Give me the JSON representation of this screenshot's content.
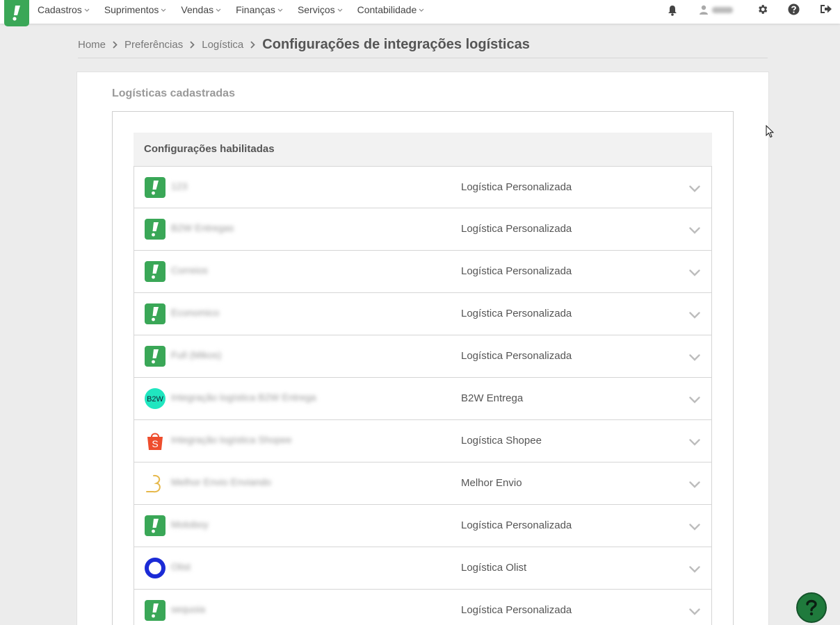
{
  "nav": {
    "items": [
      {
        "label": "Cadastros"
      },
      {
        "label": "Suprimentos"
      },
      {
        "label": "Vendas"
      },
      {
        "label": "Finanças"
      },
      {
        "label": "Serviços"
      },
      {
        "label": "Contabilidade"
      }
    ],
    "icons": [
      "bell-icon",
      "user-icon",
      "gear-icon",
      "help-icon",
      "logout-icon"
    ]
  },
  "breadcrumb": {
    "items": [
      "Home",
      "Preferências",
      "Logística"
    ],
    "current": "Configurações de integrações logísticas"
  },
  "section": {
    "title": "Logísticas cadastradas",
    "header": "Configurações habilitadas"
  },
  "rows": [
    {
      "name": "123",
      "type": "Logística Personalizada",
      "icon": "tiny-logo"
    },
    {
      "name": "B2W Entregas",
      "type": "Logística Personalizada",
      "icon": "tiny-logo"
    },
    {
      "name": "Correios",
      "type": "Logística Personalizada",
      "icon": "tiny-logo"
    },
    {
      "name": "Economico",
      "type": "Logística Personalizada",
      "icon": "tiny-logo"
    },
    {
      "name": "Full (Mikos)",
      "type": "Logística Personalizada",
      "icon": "tiny-logo"
    },
    {
      "name": "Integração logística B2W Entrega",
      "type": "B2W Entrega",
      "icon": "b2w-logo"
    },
    {
      "name": "Integração logística Shopee",
      "type": "Logística Shopee",
      "icon": "shopee-logo"
    },
    {
      "name": "Melhor Envio Enviando",
      "type": "Melhor Envio",
      "icon": "melhor-envio-logo"
    },
    {
      "name": "Motoboy",
      "type": "Logística Personalizada",
      "icon": "tiny-logo"
    },
    {
      "name": "Olist",
      "type": "Logística Olist",
      "icon": "olist-logo"
    },
    {
      "name": "sequoia",
      "type": "Logística Personalizada",
      "icon": "tiny-logo"
    }
  ],
  "b2w_text": "B2W",
  "shopee_text": "S",
  "colors": {
    "brand": "#3aa757",
    "b2w": "#20e6c0",
    "shopee": "#ee4d2d",
    "olist": "#1b2bd6"
  }
}
